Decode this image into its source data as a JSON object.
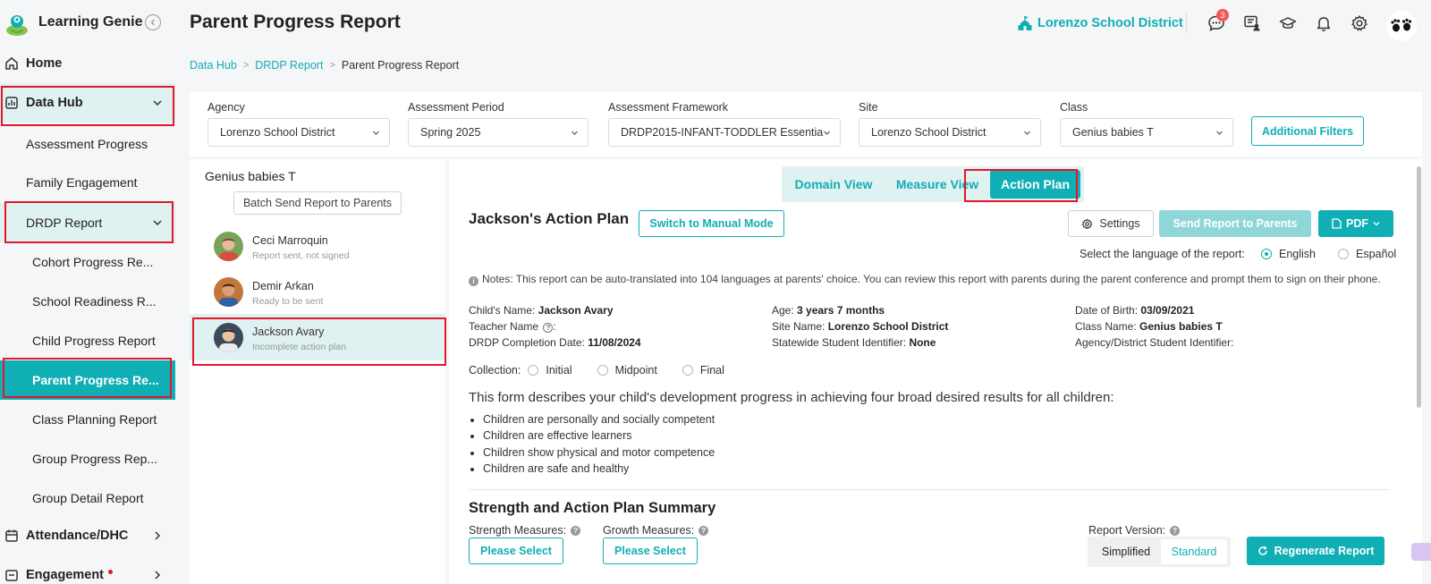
{
  "brand": {
    "name": "Learning Genie"
  },
  "sidebar": {
    "home": "Home",
    "data_hub": "Data Hub",
    "assessment_progress": "Assessment Progress",
    "family_engagement": "Family Engagement",
    "drdp_report": "DRDP Report",
    "cohort_progress": "Cohort Progress Re...",
    "school_readiness": "School Readiness R...",
    "child_progress": "Child Progress Report",
    "parent_progress": "Parent Progress Re...",
    "class_planning": "Class Planning Report",
    "group_progress": "Group Progress Rep...",
    "group_detail": "Group Detail Report",
    "attendance": "Attendance/DHC",
    "engagement": "Engagement"
  },
  "header": {
    "title": "Parent Progress Report",
    "district": "Lorenzo School District",
    "messages_count": "3"
  },
  "breadcrumb": [
    "Data Hub",
    "DRDP Report",
    "Parent Progress Report"
  ],
  "filters": {
    "agency_label": "Agency",
    "agency_value": "Lorenzo School District",
    "period_label": "Assessment Period",
    "period_value": "Spring 2025",
    "framework_label": "Assessment Framework",
    "framework_value": "DRDP2015-INFANT-TODDLER Essentia",
    "site_label": "Site",
    "site_value": "Lorenzo School District",
    "class_label": "Class",
    "class_value": "Genius babies T",
    "additional": "Additional Filters"
  },
  "students": {
    "class_name": "Genius babies T",
    "batch_button": "Batch Send Report to Parents",
    "list": [
      {
        "name": "Ceci Marroquin",
        "status": "Report sent, not signed"
      },
      {
        "name": "Demir Arkan",
        "status": "Ready to be sent"
      },
      {
        "name": "Jackson Avary",
        "status": "Incomplete action plan"
      }
    ]
  },
  "main": {
    "tabs": [
      "Domain View",
      "Measure View",
      "Action Plan"
    ],
    "plan_title": "Jackson's Action Plan",
    "switch_button": "Switch to Manual Mode",
    "settings_button": "Settings",
    "send_button": "Send Report to Parents",
    "pdf_button": "PDF",
    "lang_label": "Select the language of the report:",
    "lang_english": "English",
    "lang_spanish": "Español",
    "notes": "Notes: This report can be auto-translated into 104 languages at parents' choice. You can review this report with parents during the parent conference and prompt them to sign on their phone.",
    "child_name_label": "Child's Name:",
    "child_name": "Jackson Avary",
    "age_label": "Age:",
    "age": "3 years 7 months",
    "dob_label": "Date of Birth:",
    "dob": "03/09/2021",
    "teacher_label": "Teacher Name",
    "site_label": "Site Name:",
    "site": "Lorenzo School District",
    "class_label": "Class Name:",
    "class": "Genius babies T",
    "completion_label": "DRDP Completion Date:",
    "completion": "11/08/2024",
    "ssid_label": "Statewide Student Identifier:",
    "ssid": "None",
    "agency_id_label": "Agency/District Student Identifier:",
    "collection_label": "Collection:",
    "collection_options": [
      "Initial",
      "Midpoint",
      "Final"
    ],
    "form_desc": "This form describes your child's development progress in achieving four broad desired results for all children:",
    "bullets": [
      "Children are personally and socially competent",
      "Children are effective learners",
      "Children show physical and motor competence",
      "Children are safe and healthy"
    ],
    "summary_title": "Strength and Action Plan Summary",
    "strength_label": "Strength Measures:",
    "growth_label": "Growth Measures:",
    "please_select": "Please Select",
    "report_version_label": "Report Version:",
    "version_simplified": "Simplified",
    "version_standard": "Standard",
    "regenerate": "Regenerate Report"
  },
  "colors": {
    "accent": "#10aeb5",
    "highlight_box": "#e3172b"
  }
}
